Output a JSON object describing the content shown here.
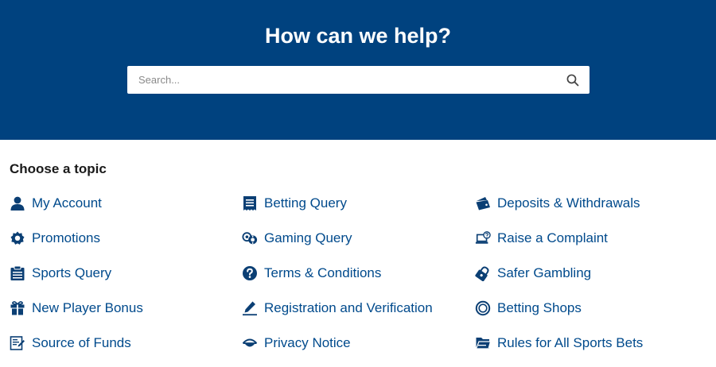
{
  "hero": {
    "title": "How can we help?",
    "search_placeholder": "Search...",
    "search_value": "",
    "search_icon": "search-icon"
  },
  "topics_heading": "Choose a topic",
  "colors": {
    "banner": "#00427f",
    "link": "#004a8c",
    "icon": "#0b3f74"
  },
  "topics": [
    {
      "label": "My Account",
      "icon": "user-icon"
    },
    {
      "label": "Betting Query",
      "icon": "receipt-icon"
    },
    {
      "label": "Deposits & Withdrawals",
      "icon": "wallet-icon"
    },
    {
      "label": "Promotions",
      "icon": "badge-icon"
    },
    {
      "label": "Gaming Query",
      "icon": "casino-chips-icon"
    },
    {
      "label": "Raise a Complaint",
      "icon": "laptop-question-icon"
    },
    {
      "label": "Sports Query",
      "icon": "clipboard-icon"
    },
    {
      "label": "Terms & Conditions",
      "icon": "question-circle-icon"
    },
    {
      "label": "Safer Gambling",
      "icon": "padlock-icon"
    },
    {
      "label": "New Player Bonus",
      "icon": "gift-icon"
    },
    {
      "label": "Registration and Verification",
      "icon": "pen-icon"
    },
    {
      "label": "Betting Shops",
      "icon": "ring-icon"
    },
    {
      "label": "Source of Funds",
      "icon": "document-pen-icon"
    },
    {
      "label": "Privacy Notice",
      "icon": "privacy-eye-icon"
    },
    {
      "label": "Rules for All Sports Bets",
      "icon": "folder-icon"
    }
  ]
}
